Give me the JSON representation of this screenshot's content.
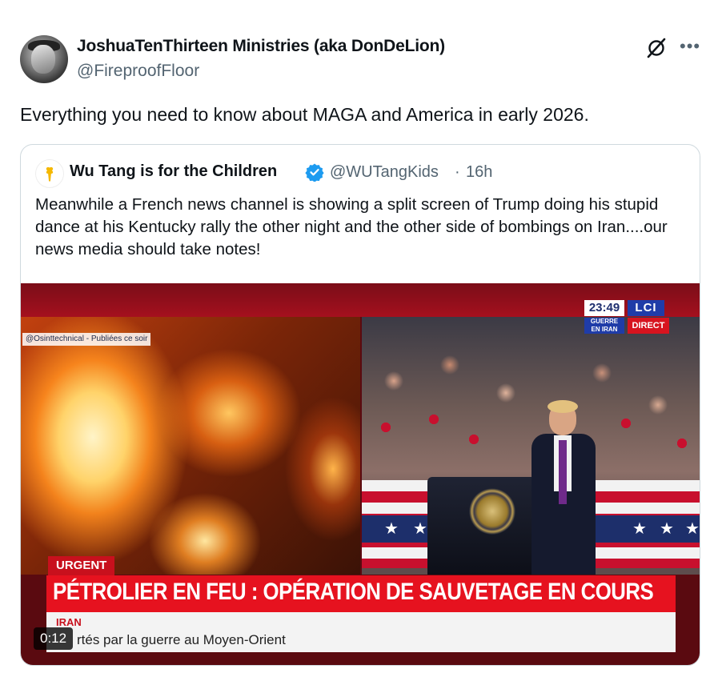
{
  "author": {
    "name": "JoshuaTenThirteen Ministries (aka DonDeLion)",
    "handle": "@FireproofFloor"
  },
  "tweet": {
    "text": "Everything you need to know about MAGA and America in early 2026."
  },
  "icons": {
    "grok": "grok-icon",
    "more": "more-icon",
    "verified": "verified-badge-icon"
  },
  "quote": {
    "name": "Wu Tang is for the Children",
    "handle": "@WUTangKids",
    "separator": "·",
    "time": "16h",
    "text": "Meanwhile a French news channel is showing a split screen of Trump doing his stupid dance at his Kentucky rally the other night and the other side of bombings on Iran....our news media should take notes!"
  },
  "video": {
    "duration": "0:12",
    "source_tag": "@Osinttechnical - Publiées ce soir",
    "clock": "23:49",
    "channel": "LCI",
    "guerre_line1": "GUERRE",
    "guerre_line2": "EN IRAN",
    "direct": "DIRECT",
    "urgent": "URGENT",
    "headline": "PÉTROLIER EN FEU : OPÉRATION DE SAUVETAGE EN COURS",
    "sub_tag": "IRAN",
    "subline": "rtés par la guerre au Moyen-Orient"
  },
  "colors": {
    "verified_blue": "#1d9bf0",
    "secondary_text": "#536471",
    "news_red": "#e6121f"
  }
}
